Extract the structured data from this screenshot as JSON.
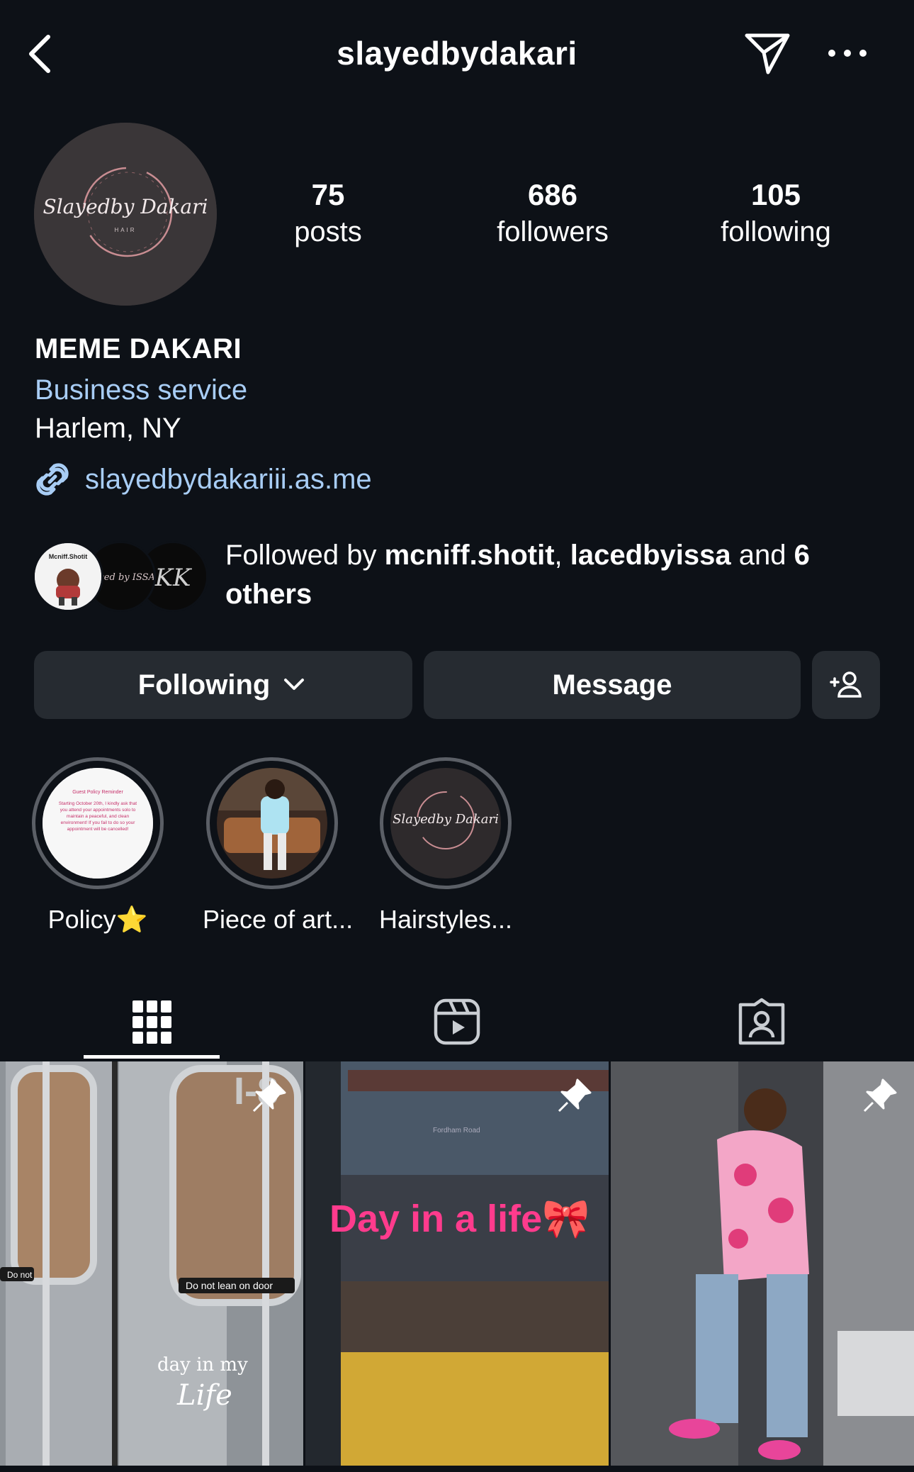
{
  "header": {
    "username": "slayedbydakari"
  },
  "profile": {
    "avatar_logo_text": "Slayedby Dakari",
    "avatar_logo_sub": "HAIR",
    "stats": [
      {
        "value": "75",
        "label": "posts"
      },
      {
        "value": "686",
        "label": "followers"
      },
      {
        "value": "105",
        "label": "following"
      }
    ],
    "name": "MEME DAKARI",
    "category": "Business service",
    "location": "Harlem, NY",
    "link": "slayedbydakariii.as.me"
  },
  "followed_by": {
    "prefix": "Followed by ",
    "user1": "mcniff.shotit",
    "sep": ", ",
    "user2": "lacedbyissa",
    "and": " and ",
    "count": "6",
    "suffix": "others",
    "avatar1_text": "Mcniff.Shotit",
    "avatar2_text": "Laced by ISSA",
    "avatar3_text": "KK"
  },
  "actions": {
    "following_label": "Following",
    "message_label": "Message"
  },
  "highlights": [
    {
      "label": "Policy⭐",
      "thumb_title": "Guest Policy Reminder",
      "thumb_body": "Starting October 20th, I kindly ask that you attend your appointments solo to maintain a peaceful, and clean environment! If you fail to do so your appointment will be cancelled!"
    },
    {
      "label": "Piece of art..."
    },
    {
      "label": "Hairstyles...",
      "thumb_logo": "Slayedby Dakari"
    }
  ],
  "posts": [
    {
      "overlay_top": "I-8",
      "door_left": "Do not",
      "door_right": "Do not lean on door",
      "caption1": "day in my",
      "caption2": "Life"
    },
    {
      "station": "Fordham Road",
      "caption": "Day in a life🎀"
    },
    {}
  ],
  "colors": {
    "background": "#0d1117",
    "button": "#262b31",
    "link": "#a8cdf5",
    "ring": "#5b5f66"
  }
}
